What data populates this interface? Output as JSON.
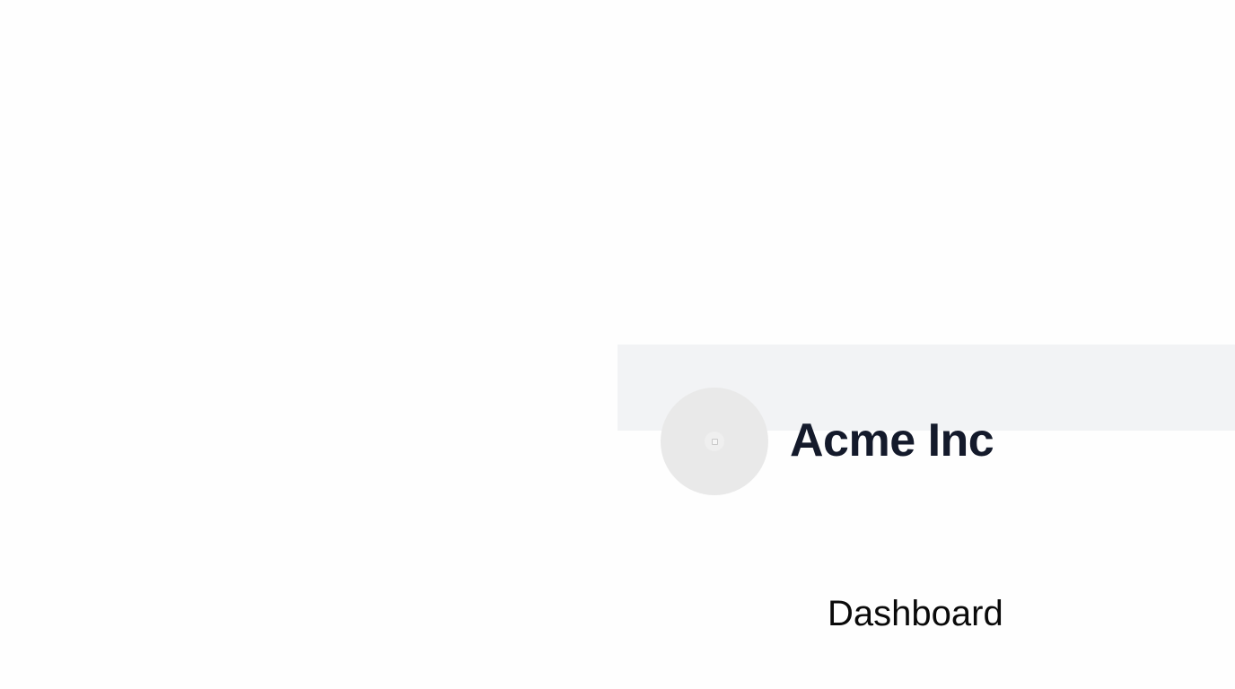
{
  "header": {
    "org_name": "Acme Inc",
    "avatar_icon": "image-placeholder-icon"
  },
  "nav": {
    "dashboard_label": "Dashboard"
  },
  "colors": {
    "banner_background": "#f2f3f5",
    "avatar_background": "#e9e9e9",
    "org_name_text": "#141a2b",
    "nav_text": "#0a0a0a"
  }
}
